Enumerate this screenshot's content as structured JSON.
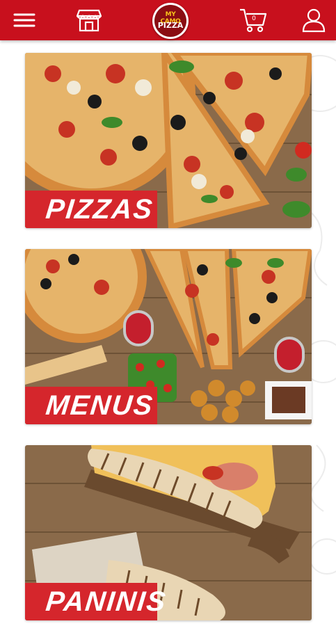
{
  "header": {
    "menu_icon": "hamburger-menu-icon",
    "store_icon": "store-icon",
    "logo": {
      "line1": "MY CAMO",
      "line2": "PIZZA"
    },
    "cart": {
      "icon": "shopping-cart-icon",
      "count": "0"
    },
    "account_icon": "user-icon",
    "brand_color": "#c8101d"
  },
  "categories": [
    {
      "label": "PIZZAS"
    },
    {
      "label": "MENUS"
    },
    {
      "label": "PANINIS"
    }
  ]
}
